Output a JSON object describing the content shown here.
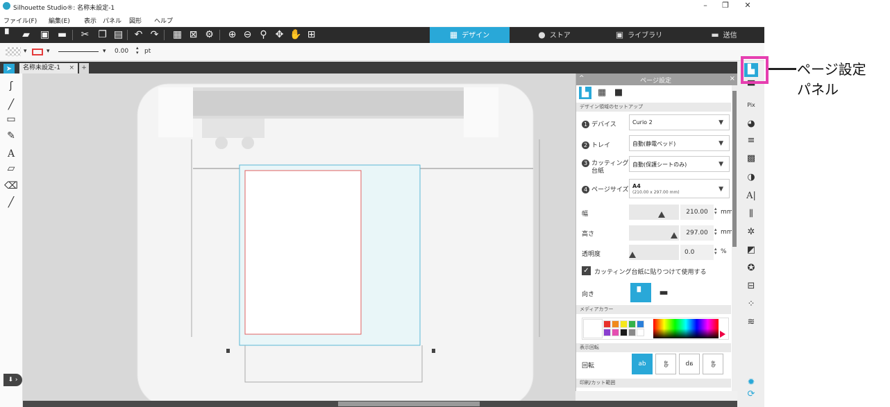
{
  "window": {
    "title": "Silhouette Studio®: 名称未設定-1",
    "minimize": "–",
    "maximize": "❐",
    "close": "✕"
  },
  "menu": [
    "ファイル(F)",
    "編集(E)",
    "表示",
    "パネル",
    "図形",
    "ヘルプ"
  ],
  "nav_tabs": [
    {
      "label": "デザイン",
      "icon": "grid-icon",
      "active": true
    },
    {
      "label": "ストア",
      "icon": "silhouette-logo-icon",
      "active": false
    },
    {
      "label": "ライブラリ",
      "icon": "library-icon",
      "active": false
    },
    {
      "label": "送信",
      "icon": "send-icon",
      "active": false
    }
  ],
  "options": {
    "line_width": "0.00",
    "unit": "pt"
  },
  "document_tab": {
    "label": "名称未設定-1",
    "close": "×",
    "add": "+"
  },
  "panel": {
    "title": "ページ設定",
    "collapse": "^",
    "close": "×",
    "section_setup": "デザイン領域のセットアップ",
    "device_label": "デバイス",
    "device_value": "Curio 2",
    "tray_label": "トレイ",
    "tray_value": "自動(静電ベッド)",
    "mat_label": "カッティング用台紙",
    "mat_label_a": "カッティング用",
    "mat_label_b": "台紙",
    "mat_value": "自動(保護シートのみ)",
    "pagesize_label": "ページサイズ",
    "pagesize_value": "A4",
    "pagesize_sub": "(210.00 x 297.00 mm)",
    "num1": "1",
    "num2": "2",
    "num3": "3",
    "num4": "4",
    "width_label": "幅",
    "width_value": "210.00",
    "height_label": "高さ",
    "height_value": "297.00",
    "opacity_label": "透明度",
    "opacity_value": "0.0",
    "unit_mm": "mm",
    "unit_pct": "%",
    "mat_check_label": "カッティング台紙に貼りつけて使用する",
    "orient_label": "向き",
    "section_media_color": "メディアカラー",
    "section_rotate": "表示回転",
    "rotate_label": "回転",
    "rotate_options": [
      "ab",
      "ab",
      "ab",
      "ab"
    ],
    "section_print_cut": "印刷/カット範囲",
    "swatches": [
      "#ffffff",
      "#e8322b",
      "#f08a1d",
      "#f6e71c",
      "#34b24a",
      "#2b7fd9",
      "#8a3fd0",
      "#e54fb1",
      "#1a1a1a",
      "#8a8a8a",
      "#ffffff"
    ]
  },
  "callout": {
    "line1": "ページ設定",
    "line2": "パネル"
  },
  "colors": {
    "accent": "#29a8d8",
    "toolbar": "#2b2b2b",
    "callout_border": "#e63fb0"
  }
}
